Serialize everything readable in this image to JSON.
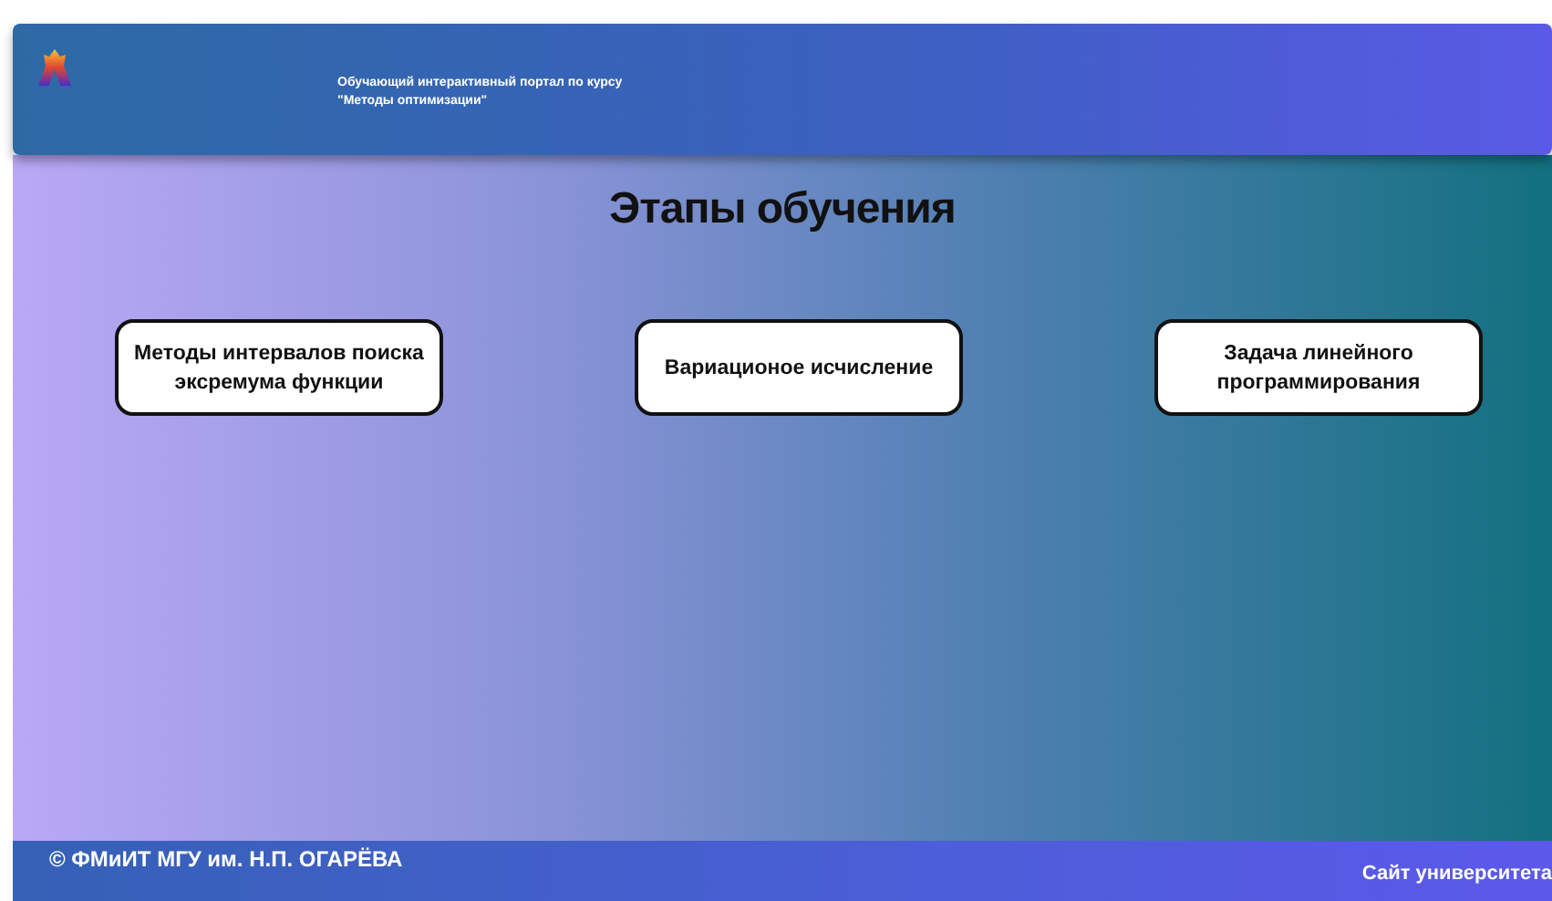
{
  "header": {
    "title_lines": [
      "Обучающий интерактивный портал по курсу",
      "\"Методы оптимизации\""
    ]
  },
  "main": {
    "heading": "Этапы обучения",
    "stages": [
      {
        "label": "Методы интервалов поиска эксремума функции"
      },
      {
        "label": "Вариационое исчисление"
      },
      {
        "label": "Задача линейного программирования"
      }
    ]
  },
  "footer": {
    "copyright": "© ФМиИТ МГУ им. Н.П. ОГАРЁВА",
    "link": "Сайт университета"
  }
}
